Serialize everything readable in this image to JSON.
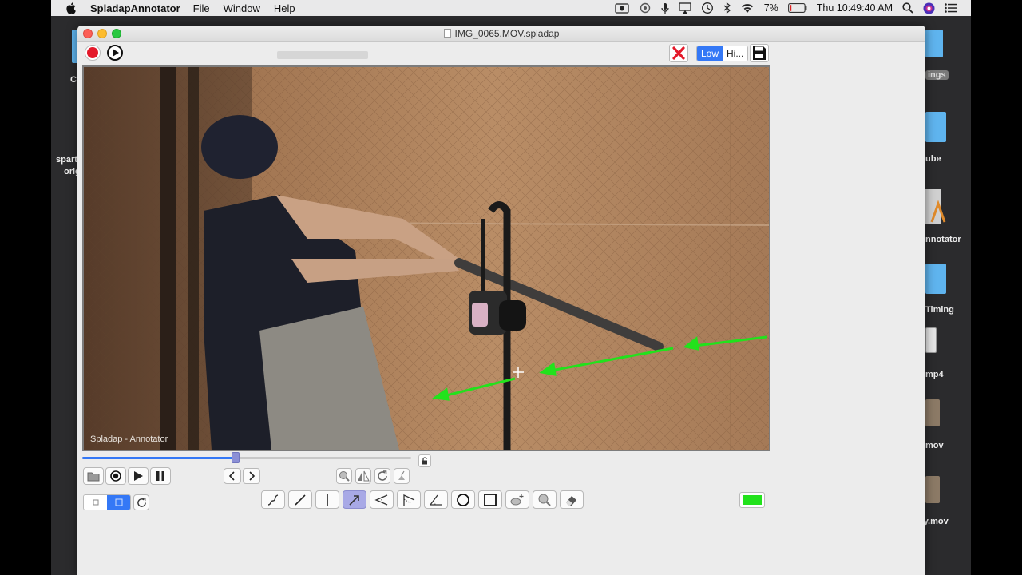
{
  "menubar": {
    "app_name": "SpladapAnnotator",
    "menus": [
      "File",
      "Window",
      "Help"
    ],
    "battery": "7%",
    "clock": "Thu 10:49:40 AM"
  },
  "desktop": {
    "left_labels": [
      "C",
      "spart",
      "orig"
    ],
    "right_labels": [
      "ings",
      "ube",
      "nnotator",
      "Timing",
      "mp4",
      "mov",
      "py.mov"
    ]
  },
  "window": {
    "title": "IMG_0065.MOV.spladap",
    "quality": {
      "low": "Low",
      "high": "Hi..."
    },
    "watermark": "Spladap - Annotator",
    "scrub_progress": 0.465,
    "annotation_color": "#22e21c",
    "accent_color": "#3478f6"
  },
  "icons": {
    "playback": [
      "folder-icon",
      "record-icon",
      "play-icon",
      "pause-icon"
    ],
    "frame_step": [
      "previous-frame-icon",
      "next-frame-icon"
    ],
    "view_tools": [
      "zoom-icon",
      "flip-icon",
      "rotate-icon",
      "clear-icon"
    ],
    "draw_tools": [
      "freehand-icon",
      "line-icon",
      "vertical-line-icon",
      "arrow-icon",
      "angle-icon",
      "angle-flag-icon",
      "measure-angle-icon",
      "circle-icon",
      "rectangle-icon",
      "spotlight-icon",
      "magnifier-icon",
      "eraser-icon"
    ]
  }
}
